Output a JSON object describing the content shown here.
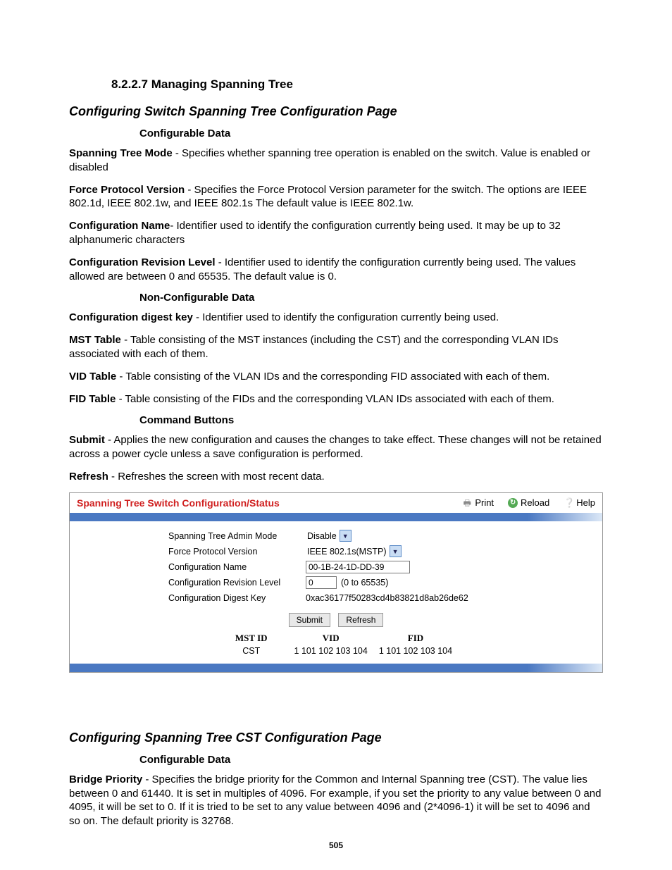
{
  "sec_num": "8.2.2.7",
  "sec_title": "Managing Spanning Tree",
  "h1": "Configuring Switch Spanning Tree Configuration Page",
  "cfg_hdr": "Configurable Data",
  "p1b": "Spanning Tree Mode",
  "p1": " - Specifies whether spanning tree operation is enabled on the switch. Value is enabled or disabled",
  "p2b": "Force Protocol Version",
  "p2": " - Specifies the Force Protocol Version parameter for the switch. The options are IEEE 802.1d, IEEE 802.1w, and IEEE 802.1s The default value is IEEE 802.1w.",
  "p3b": "Configuration Name",
  "p3": "- Identifier used to identify the configuration currently being used. It may be up to 32 alphanumeric characters",
  "p4b": "Configuration Revision Level",
  "p4": " - Identifier used to identify the configuration currently being used. The values allowed are between 0 and 65535. The default value is 0.",
  "noncfg_hdr": "Non-Configurable Data",
  "p5b": "Configuration digest key",
  "p5": " - Identifier used to identify the configuration currently being used.",
  "p6b": "MST Table",
  "p6": " - Table consisting of the MST instances (including the CST) and the corresponding VLAN IDs associated with each of them.",
  "p7b": "VID Table",
  "p7": " - Table consisting of the VLAN IDs and the corresponding FID associated with each of them.",
  "p8b": "FID Table",
  "p8": " - Table consisting of the FIDs and the corresponding VLAN IDs associated with each of them.",
  "cmd_hdr": "Command Buttons",
  "p9b": "Submit",
  "p9": " - Applies the new configuration and causes the changes to take effect. These changes will not be retained across a power cycle unless a save configuration is performed.",
  "p10b": "Refresh",
  "p10": " - Refreshes the screen with most recent data.",
  "panel": {
    "title": "Spanning Tree Switch Configuration/Status",
    "print": "Print",
    "reload": "Reload",
    "help": "Help",
    "r1l": "Spanning Tree Admin Mode",
    "r1v": "Disable",
    "r2l": "Force Protocol Version",
    "r2v": "IEEE 802.1s(MSTP)",
    "r3l": "Configuration Name",
    "r3v": "00-1B-24-1D-DD-39",
    "r4l": "Configuration Revision Level",
    "r4v": "0",
    "r4hint": "(0 to 65535)",
    "r5l": "Configuration Digest Key",
    "r5v": "0xac36177f50283cd4b83821d8ab26de62",
    "submit": "Submit",
    "refresh": "Refresh",
    "th1": "MST ID",
    "th2": "VID",
    "th3": "FID",
    "td1": "CST",
    "td2": "1 101 102 103 104",
    "td3": "1 101 102 103 104"
  },
  "h2": "Configuring Spanning Tree CST Configuration Page",
  "cfg_hdr2": "Configurable Data",
  "p11b": "Bridge Priority",
  "p11": " - Specifies the bridge priority for the Common and Internal Spanning tree (CST). The value lies between 0 and 61440. It is set in multiples of 4096. For example, if you set the priority to any value between 0 and 4095, it will be set to 0. If it is tried to be set to any value between 4096 and (2*4096-1) it will be set to 4096 and so on. The default priority is 32768.",
  "pagenum": "505"
}
